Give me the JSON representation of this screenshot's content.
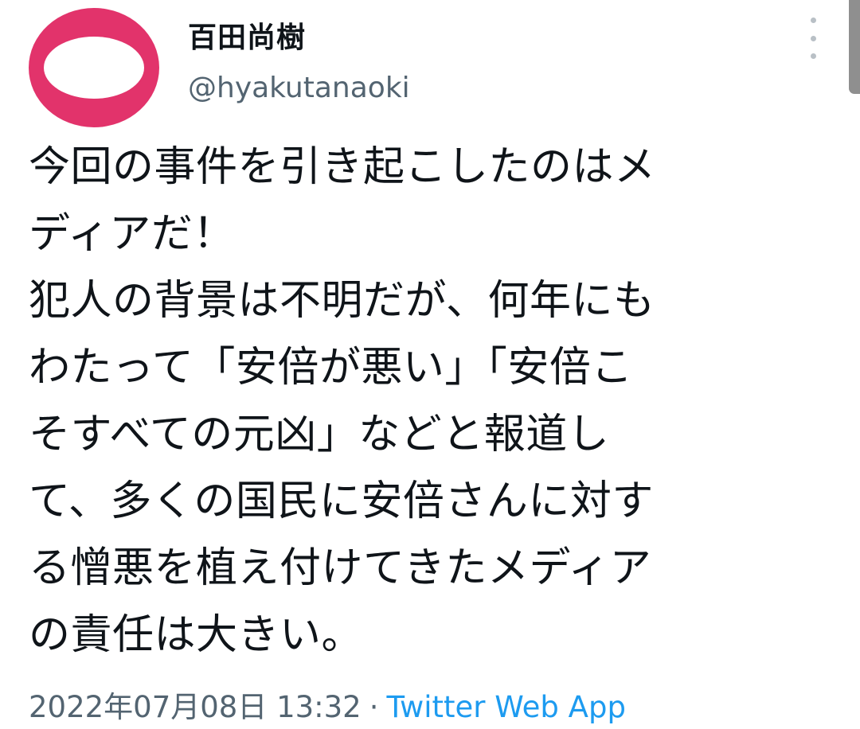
{
  "author": {
    "display_name": "百田尚樹",
    "handle": "@hyakutanaoki",
    "avatar_color": "#e2336b"
  },
  "tweet": {
    "lines": [
      "今回の事件を引き起こしたのはメ",
      "ディアだ！",
      "犯人の背景は不明だが、何年にも",
      "わたって「安倍が悪い」「安倍こ",
      "そすべての元凶」などと報道し",
      "て、多くの国民に安倍さんに対す",
      "る憎悪を植え付けてきたメディア",
      "の責任は大きい。"
    ]
  },
  "meta": {
    "timestamp": "2022年07月08日 13:32",
    "separator": "·",
    "source": "Twitter Web App"
  },
  "icons": {
    "more": "more-vertical-icon"
  },
  "colors": {
    "text": "#0f1419",
    "secondary": "#536471",
    "link": "#1d9bf0"
  }
}
